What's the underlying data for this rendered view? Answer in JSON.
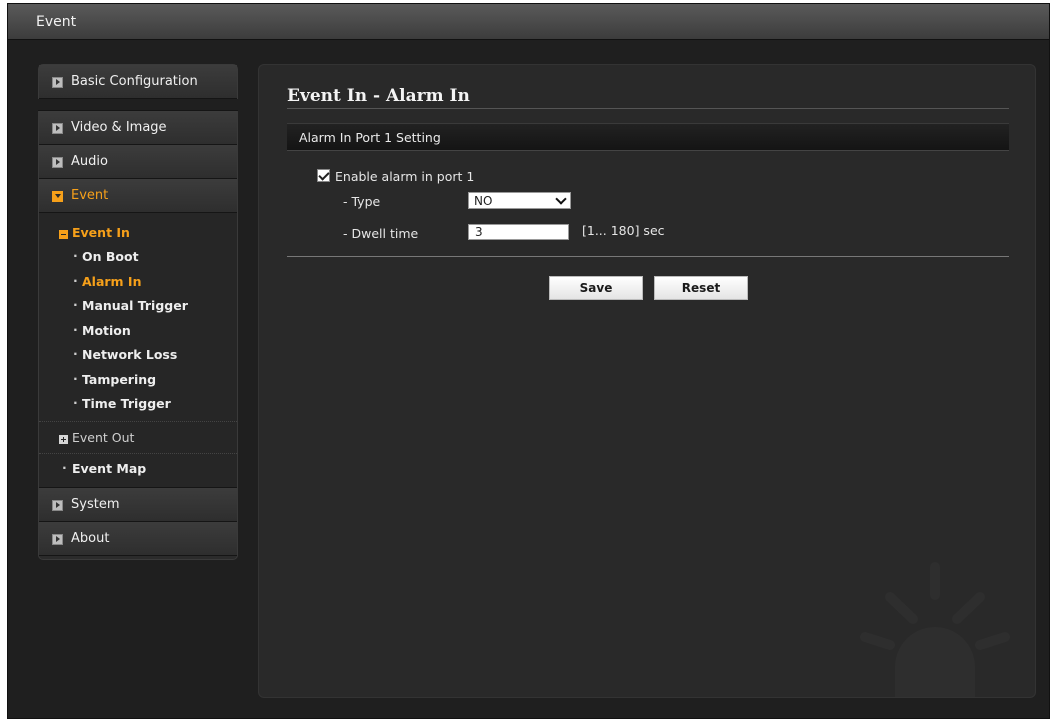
{
  "window": {
    "title": "Event"
  },
  "sidebar": {
    "basic_configuration": "Basic Configuration",
    "video_image": "Video & Image",
    "audio": "Audio",
    "event": "Event",
    "event_in": "Event In",
    "event_in_items": [
      "On Boot",
      "Alarm In",
      "Manual Trigger",
      "Motion",
      "Network Loss",
      "Tampering",
      "Time Trigger"
    ],
    "event_out": "Event Out",
    "event_map": "Event Map",
    "system": "System",
    "about": "About"
  },
  "main": {
    "page_title": "Event In - Alarm In",
    "section_title": "Alarm In Port 1 Setting",
    "enable_label": "Enable alarm in port 1",
    "enable_checked": true,
    "type_label": "- Type",
    "type_value": "NO",
    "dwell_label": "- Dwell time",
    "dwell_value": "3",
    "dwell_range": "[1... 180] sec",
    "save_label": "Save",
    "reset_label": "Reset"
  },
  "colors": {
    "accent": "#f6a01a",
    "background": "#1f1f1f",
    "panel": "#292929"
  },
  "icons": {
    "menu_collapsed": "arrow-square-icon",
    "menu_expanded": "chevron-down-square-icon",
    "watermark": "alarm-siren-icon"
  }
}
